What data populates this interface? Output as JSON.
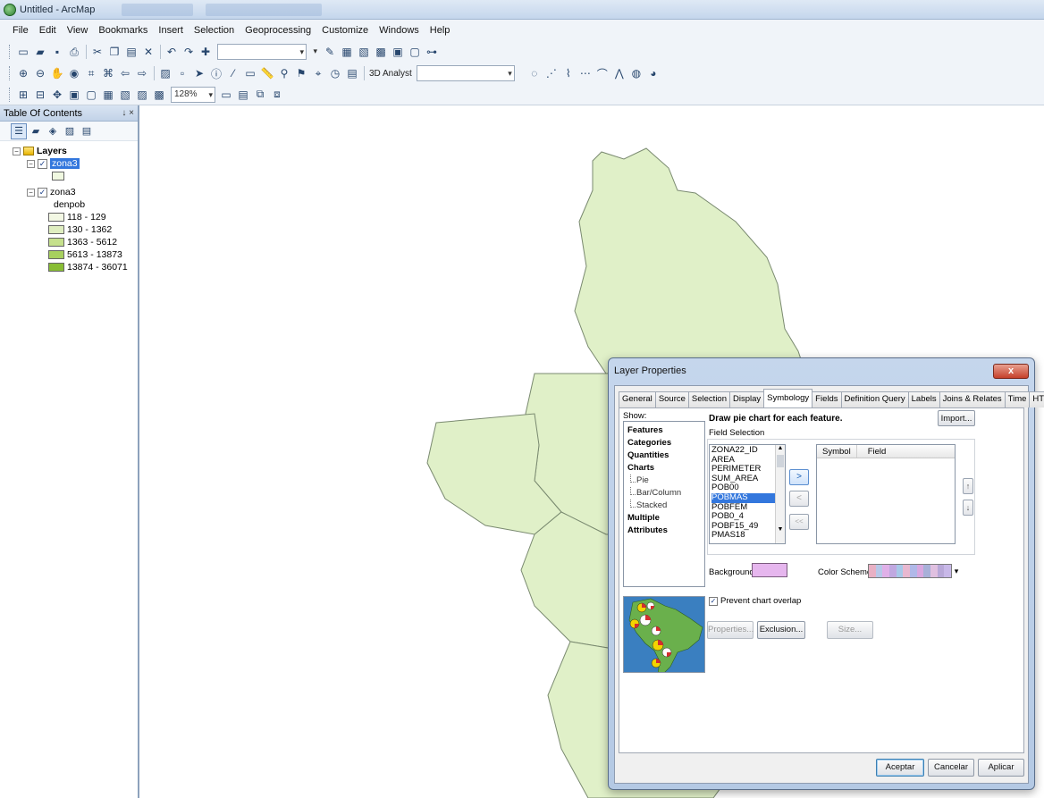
{
  "window": {
    "title": "Untitled - ArcMap"
  },
  "menu": [
    "File",
    "Edit",
    "View",
    "Bookmarks",
    "Insert",
    "Selection",
    "Geoprocessing",
    "Customize",
    "Windows",
    "Help"
  ],
  "toolbar": {
    "analyst_label": "3D Analyst",
    "zoom_level": "128%"
  },
  "toc": {
    "title": "Table Of Contents",
    "pin": "↓ ×",
    "root": "Layers",
    "layer1": "zona3",
    "layer2": "zona3",
    "field": "denpob",
    "classes": [
      {
        "label": "118 - 129",
        "color": "#f3f8e4"
      },
      {
        "label": "130 - 1362",
        "color": "#dfeec0"
      },
      {
        "label": "1363 - 5612",
        "color": "#c5e08c"
      },
      {
        "label": "5613 - 13873",
        "color": "#a7d05e"
      },
      {
        "label": "13874 - 36071",
        "color": "#88bd34"
      }
    ]
  },
  "map": {
    "polygon_fill": "#e0f0c8",
    "polygon_stroke": "#7a8a70"
  },
  "dialog": {
    "title": "Layer Properties",
    "close": "x",
    "tabs": [
      "General",
      "Source",
      "Selection",
      "Display",
      "Symbology",
      "Fields",
      "Definition Query",
      "Labels",
      "Joins & Relates",
      "Time",
      "HTML Popup"
    ],
    "active_tab": "Symbology",
    "show_label": "Show:",
    "show_items": [
      {
        "label": "Features",
        "sub": false
      },
      {
        "label": "Categories",
        "sub": false
      },
      {
        "label": "Quantities",
        "sub": false
      },
      {
        "label": "Charts",
        "sub": false
      },
      {
        "label": "Pie",
        "sub": true
      },
      {
        "label": "Bar/Column",
        "sub": true
      },
      {
        "label": "Stacked",
        "sub": true
      },
      {
        "label": "Multiple Attributes",
        "sub": false
      }
    ],
    "draw_label": "Draw pie chart for each feature.",
    "import_button": "Import...",
    "field_selection_label": "Field Selection",
    "fields": [
      "ZONA22_ID",
      "AREA",
      "PERIMETER",
      "SUM_AREA",
      "POB00",
      "POBMAS",
      "POBFEM",
      "POB0_4",
      "POBF15_49",
      "PMAS18"
    ],
    "selected_field": "POBMAS",
    "symbol_header": "Symbol",
    "field_header": "Field",
    "add_arrow": ">",
    "remove_arrow": "<",
    "remove_all_arrow": "<<",
    "up_arrow": "↑",
    "down_arrow": "↓",
    "background_label": "Background:",
    "background_color": "#e6b6ee",
    "color_scheme_label": "Color Scheme:",
    "color_scheme": [
      "#e8b0c4",
      "#b8c8e8",
      "#e0b0e8",
      "#c0a8e0",
      "#a8c8e8",
      "#e8b8d0",
      "#b0b8e8",
      "#d8a8e0",
      "#a8b0d8",
      "#e0c0e0",
      "#b8a8d8",
      "#c8b8e8"
    ],
    "prevent_overlap_label": "Prevent chart overlap",
    "prevent_overlap_checked": "✓",
    "properties_button": "Properties...",
    "exclusion_button": "Exclusion...",
    "size_button": "Size...",
    "accept_button": "Aceptar",
    "cancel_button": "Cancelar",
    "apply_button": "Aplicar"
  }
}
